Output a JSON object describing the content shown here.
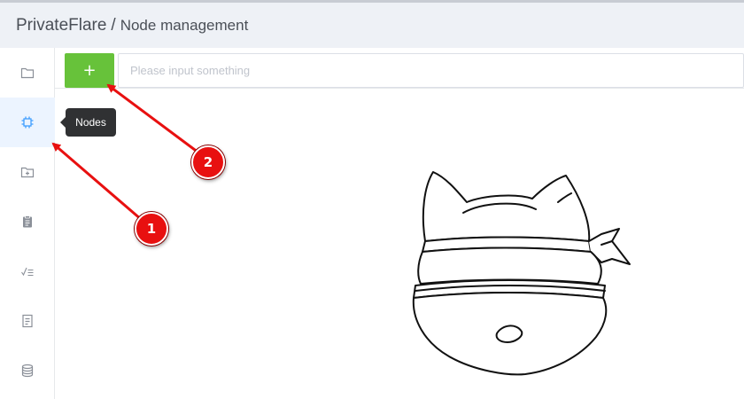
{
  "header": {
    "brand": "PrivateFlare",
    "separator": "/",
    "page_title": "Node management"
  },
  "sidebar": {
    "items": [
      {
        "icon": "folder-icon",
        "active": false
      },
      {
        "icon": "chip-icon",
        "active": true,
        "tooltip": "Nodes"
      },
      {
        "icon": "folder-plus-icon",
        "active": false
      },
      {
        "icon": "clipboard-icon",
        "active": false
      },
      {
        "icon": "checklist-icon",
        "active": false
      },
      {
        "icon": "document-icon",
        "active": false
      },
      {
        "icon": "database-icon",
        "active": false
      }
    ]
  },
  "tooltip": {
    "text": "Nodes"
  },
  "toolbar": {
    "add_label": "+",
    "search_placeholder": "Please input something",
    "search_value": ""
  },
  "annotations": [
    {
      "label": "1"
    },
    {
      "label": "2"
    }
  ],
  "colors": {
    "accent": "#409eff",
    "add_button": "#67c23a",
    "annotation": "#e81010",
    "header_bg": "#eef1f6",
    "tooltip_bg": "#303133"
  }
}
